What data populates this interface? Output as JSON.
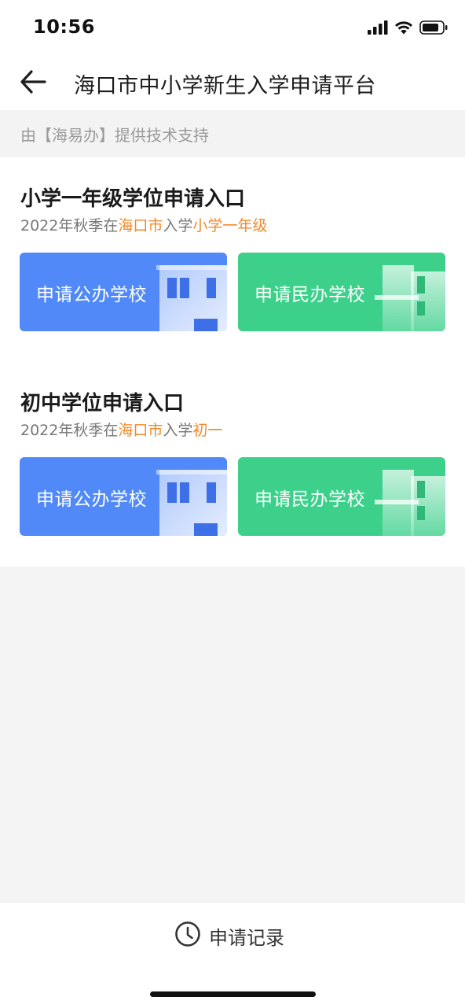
{
  "status_bar": {
    "time": "10:56",
    "icons": [
      "signal-icon",
      "wifi-icon",
      "battery-icon"
    ]
  },
  "nav": {
    "back_icon": "back-arrow-icon",
    "title": "海口市中小学新生入学申请平台"
  },
  "support_text": "由【海易办】提供技术支持",
  "sections": [
    {
      "title": "小学一年级学位申请入口",
      "subtitle": {
        "part1": "2022年秋季在",
        "city": "海口市",
        "part2": "入学",
        "grade": "小学一年级"
      },
      "buttons": {
        "public": "申请公办学校",
        "private": "申请民办学校"
      }
    },
    {
      "title": "初中学位申请入口",
      "subtitle": {
        "part1": "2022年秋季在",
        "city": "海口市",
        "part2": "入学",
        "grade": "初一"
      },
      "buttons": {
        "public": "申请公办学校",
        "private": "申请民办学校"
      }
    }
  ],
  "footer": {
    "icon": "clock-icon",
    "label": "申请记录"
  },
  "colors": {
    "public_card": "#5189f8",
    "private_card": "#3dd08b",
    "highlight": "#f08a2a",
    "background": "#f4f4f5"
  }
}
